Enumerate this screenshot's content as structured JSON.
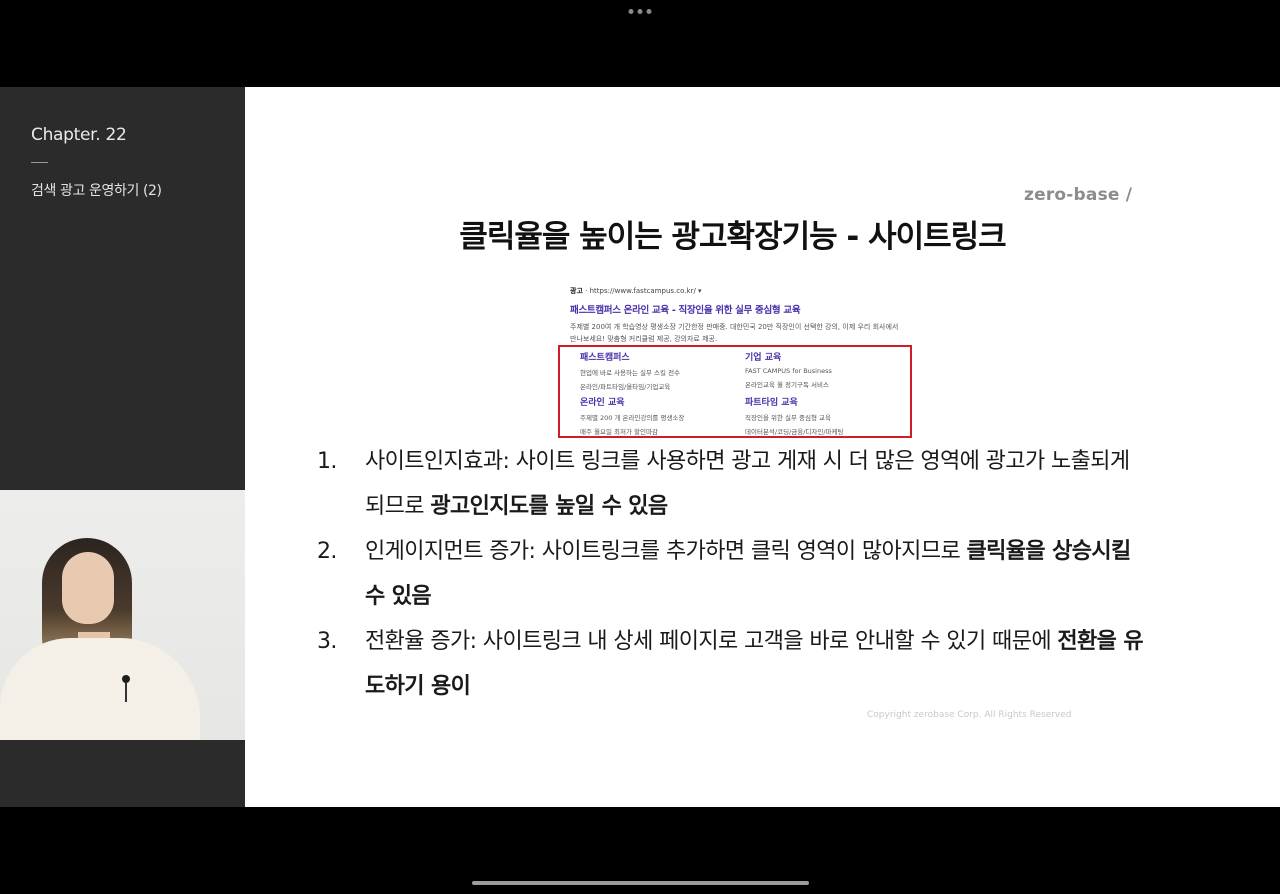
{
  "sidebar": {
    "chapter": "Chapter. 22",
    "lesson": "검색 광고 운영하기 (2)"
  },
  "slide": {
    "brand": "zero-base /",
    "title": "클릭율을 높이는 광고확장기능 - 사이트링크",
    "ad": {
      "label": "광고",
      "url": "· https://www.fastcampus.co.kr/ ▾",
      "headline": "패스트캠퍼스 온라인 교육 - 직장인을 위한 실무 중심형 교육",
      "description": "주제별 200여 개 학습영상 평생소장 기간한정 판매중. 대한민국 20만 직장인이 선택한 강의, 이제 우리 회사에서 만나보세요! 맞춤형 커리큘럼 제공, 강의자료 제공.",
      "sitelinks": [
        {
          "title": "패스트캠퍼스",
          "line1": "현업에 바로 사용하는 실무 스킬 전수",
          "line2": "온라인/파트타임/올타임/기업교육"
        },
        {
          "title": "기업 교육",
          "line1": "FAST CAMPUS for Business",
          "line2": "온라인교육 월 정기구독 서비스"
        },
        {
          "title": "온라인 교육",
          "line1": "주제별 200 개 온라인강의를 평생소장",
          "line2": "매주 월요일 최저가 할인마감"
        },
        {
          "title": "파트타임 교육",
          "line1": "직장인을 위한 실무 중심형 교육",
          "line2": "데이터분석/코딩/금융/디자인/마케팅"
        }
      ]
    },
    "points": [
      {
        "num": "1.",
        "text": "사이트인지효과: 사이트 링크를 사용하면 광고 게재 시 더 많은 영역에 광고가 노출되게 되므로 ",
        "bold": "광고인지도를 높일 수 있음",
        "after": ""
      },
      {
        "num": "2.",
        "text": "인게이지먼트 증가: 사이트링크를 추가하면 클릭 영역이 많아지므로 ",
        "bold": "클릭율을 상승시킬 수 있음",
        "after": ""
      },
      {
        "num": "3.",
        "text": "전환율 증가: 사이트링크 내 상세 페이지로 고객을 바로 안내할 수 있기 때문에 ",
        "bold": "전환을 유도하기 용이",
        "after": ""
      }
    ],
    "copyright": "Copyright zerobase Corp. All Rights Reserved"
  }
}
